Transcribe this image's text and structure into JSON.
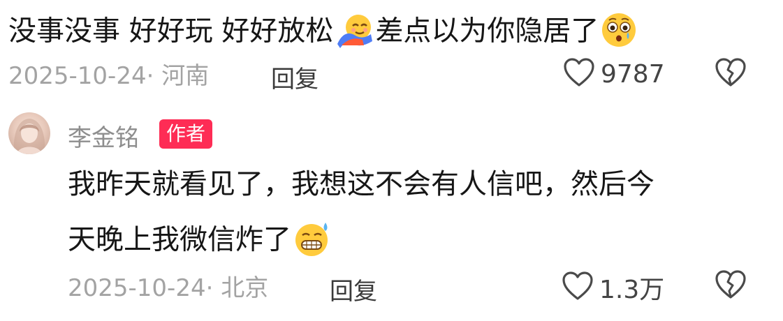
{
  "comment1": {
    "text_part1": "没事没事 好好玩 好好放松",
    "text_part2": "差点以为你隐居了",
    "emoji1": "hug-emoji",
    "emoji2": "flushed-emoji",
    "date_location": "2025-10-24· 河南",
    "reply_label": "回复",
    "like_count": "9787"
  },
  "comment2": {
    "author": "李金铭",
    "badge": "作者",
    "line1": "我昨天就看见了，我想这不会有人信吧，然后今",
    "line2": "天晚上我微信炸了",
    "emoji": "grimacing-sweat-emoji",
    "date_location": "2025-10-24· 北京",
    "reply_label": "回复",
    "like_count": "1.3万"
  },
  "icons": {
    "like": "heart-outline-icon",
    "dislike": "broken-heart-icon"
  },
  "colors": {
    "badge_bg": "#fe2c55",
    "meta_text": "#a3a3a3",
    "author_name": "#8e8e8e"
  }
}
